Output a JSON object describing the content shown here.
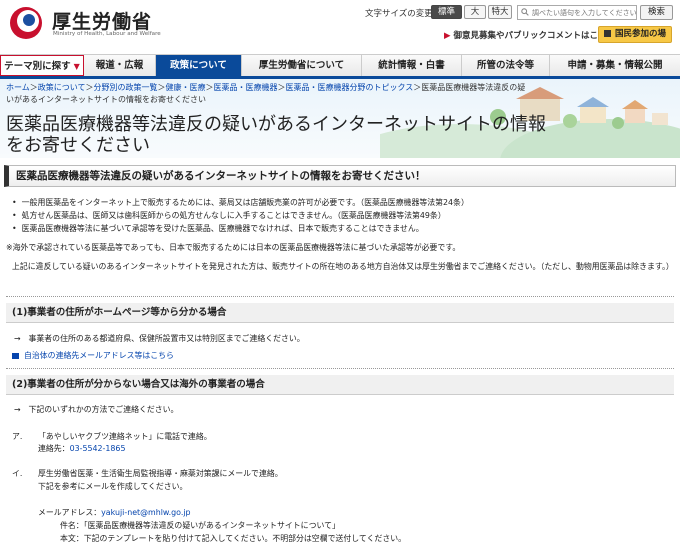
{
  "header": {
    "logo_ja": "厚生労働省",
    "logo_en": "Ministry of Health, Labour and Welfare",
    "font_size_label": "文字サイズの変更",
    "font_sizes": [
      "標準",
      "大",
      "特大"
    ],
    "search_placeholder": "調べたい語句を入力してください",
    "search_button": "検索",
    "public_comment": "御意見募集やパブリックコメントはこちら",
    "join_button": "国民参加の場"
  },
  "nav": {
    "tabs": [
      "テーマ別に探す",
      "報道・広報",
      "政策について",
      "厚生労働省について",
      "統計情報・白書",
      "所管の法令等",
      "申請・募集・情報公開"
    ],
    "active_index": 2
  },
  "breadcrumb": {
    "links": [
      "ホーム",
      "政策について",
      "分野別の政策一覧",
      "健康・医療",
      "医薬品・医療機器",
      "医薬品・医療機器分野のトピックス"
    ],
    "current": "医薬品医療機器等法違反の疑いがあるインターネットサイトの情報をお寄せください"
  },
  "page_title": "医薬品医療機器等法違反の疑いがあるインターネットサイトの情報をお寄せください",
  "section_heading": "医薬品医療機器等法違反の疑いがあるインターネットサイトの情報をお寄せください！",
  "bullets": [
    "一般用医薬品をインターネット上で販売するためには、薬局又は店舗販売業の許可が必要です。（医薬品医療機器等法第24条）",
    "処方せん医薬品は、医師又は歯科医師からの処方せんなしに入手することはできません。（医薬品医療機器等法第49条）",
    "医薬品医療機器等法に基づいて承認等を受けた医薬品、医療機器でなければ、日本で販売することはできません。"
  ],
  "note": "※海外で承認されている医薬品等であっても、日本で販売するためには日本の医薬品医療機器等法に基づいた承認等が必要です。",
  "intro": "上記に違反している疑いのあるインターネットサイトを発見された方は、販売サイトの所在地のある地方自治体又は厚生労働省までご連絡ください。（ただし、動物用医薬品は除きます。）",
  "case1": {
    "heading": "(1)事業者の住所がホームページ等から分かる場合",
    "text": "→　事業者の住所のある都道府県、保健所設置市又は特別区までご連絡ください。",
    "link": "自治体の連絡先メールアドレス等はこちら"
  },
  "case2": {
    "heading": "(2)事業者の住所が分からない場合又は海外の事業者の場合",
    "text": "→　下記のいずれかの方法でご連絡ください。",
    "a_label": "ア.",
    "a_text": "「あやしいヤクブツ連絡ネット」に電話で連絡。",
    "a_contact_label": "連絡先：",
    "a_phone": "03-5542-1865",
    "i_label": "イ.",
    "i_text": "厚生労働省医薬・生活衛生局監視指導・麻薬対策課にメールで連絡。",
    "i_sub": "下記を参考にメールを作成してください。",
    "mail_label": "メールアドレス：",
    "mail_address": "yakuji-net@mhlw.go.jp",
    "subject_label": "件名：",
    "subject": "「医薬品医療機器等法違反の疑いがあるインターネットサイトについて」",
    "body_label": "本文：",
    "body": "下記のテンプレートを貼り付けて記入してください。不明部分は空欄で送付してください。"
  },
  "colors": {
    "nav_active": "#0a4a9a",
    "accent_red": "#c8102e",
    "join_button": "#f7c846",
    "link": "#0645ad"
  }
}
